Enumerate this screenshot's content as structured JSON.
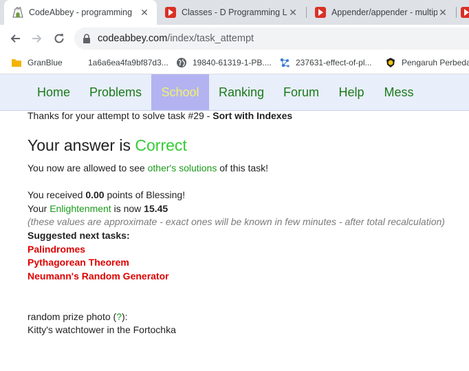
{
  "tabs": [
    {
      "title": "CodeAbbey - programming",
      "active": true
    },
    {
      "title": "Classes - D Programming La",
      "active": false
    },
    {
      "title": "Appender/appender - multip",
      "active": false
    }
  ],
  "toolbar": {
    "url_host": "codeabbey.com",
    "url_path": "/index/task_attempt"
  },
  "bookmarks": [
    {
      "label": "GranBlue",
      "icon": "folder-icon"
    },
    {
      "label": "1a6a6ea4fa9bf87d3...",
      "icon": "blank-page-icon"
    },
    {
      "label": "19840-61319-1-PB....",
      "icon": "globe-icon"
    },
    {
      "label": "237631-effect-of-pl...",
      "icon": "network-icon"
    },
    {
      "label": "Pengaruh Perbedaa",
      "icon": "emblem-icon"
    }
  ],
  "site_nav": [
    {
      "label": "Home",
      "active": false
    },
    {
      "label": "Problems",
      "active": false
    },
    {
      "label": "School",
      "active": true
    },
    {
      "label": "Ranking",
      "active": false
    },
    {
      "label": "Forum",
      "active": false
    },
    {
      "label": "Help",
      "active": false
    },
    {
      "label": "Mess",
      "active": false
    }
  ],
  "content": {
    "thanks_prefix": "Thanks for your attempt to solve task #29 - ",
    "task_name": "Sort with Indexes",
    "answer_prefix": "Your answer is ",
    "answer_result": "Correct",
    "allowed_prefix": "You now are allowed to see ",
    "others_link": "other's solutions",
    "allowed_suffix": " of this task!",
    "blessing_prefix": "You received ",
    "blessing_points": "0.00",
    "blessing_suffix": " points of Blessing!",
    "enlight_prefix": "Your ",
    "enlight_link": "Enlightenment",
    "enlight_middle": " is now ",
    "enlight_value": "15.45",
    "approx_note": "(these values are approximate - exact ones will be known in few minutes - after total recalculation)",
    "suggested_heading": "Suggested next tasks:",
    "suggested": [
      "Palindromes",
      "Pythagorean Theorem",
      "Neumann's Random Generator"
    ],
    "prize_prefix": "random prize photo (",
    "prize_link": "?",
    "prize_suffix": "):",
    "prize_caption": "Kitty's watchtower in the Fortochka"
  },
  "colors": {
    "nav_green": "#1a7a1a",
    "nav_active_bg": "#b3b3f2",
    "nav_active_text": "#f3f06a",
    "correct_green": "#33cc33",
    "link_green": "#1a9a1a",
    "suggested_red": "#dd0000"
  }
}
